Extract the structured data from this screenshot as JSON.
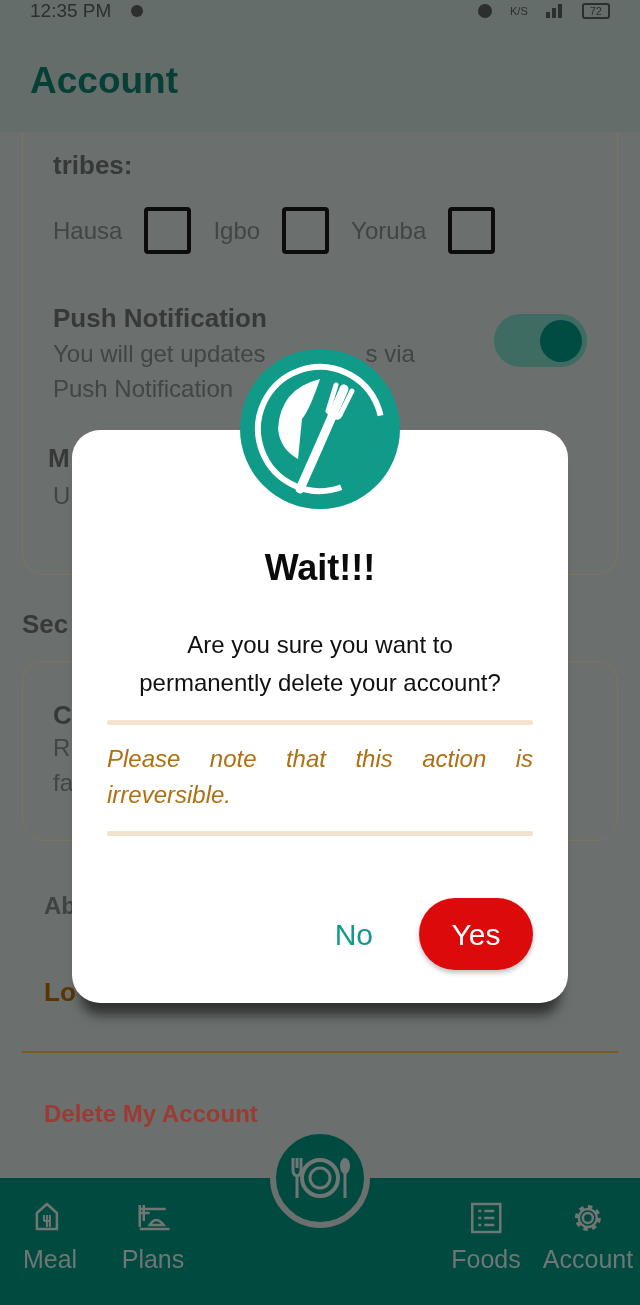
{
  "status_bar": {
    "time": "12:35 PM",
    "network_speed": "K/S",
    "battery": "72"
  },
  "app_bar": {
    "title": "Account"
  },
  "tribes": {
    "label": "tribes:",
    "options": [
      {
        "label": "Hausa",
        "checked": false
      },
      {
        "label": "Igbo",
        "checked": false
      },
      {
        "label": "Yoruba",
        "checked": false
      }
    ]
  },
  "push_notification": {
    "title": "Push Notification",
    "description_start": "You will get updates",
    "description_end": "s via",
    "description_line_2": "Push Notification",
    "on": true
  },
  "partial_card": {
    "title": "M",
    "subtitle": "U"
  },
  "section_title": "Sec",
  "card_2": {
    "title": "C",
    "lines": [
      "R",
      "fa"
    ]
  },
  "links": [
    {
      "label": "Ab",
      "kind": "plain"
    },
    {
      "label": "Lo",
      "kind": "accent"
    }
  ],
  "delete_account": "Delete My Account",
  "dialog": {
    "title": "Wait!!!",
    "message": "Are you sure you want to permanently delete your account?",
    "note": "Please note that this action is irreversible.",
    "buttons": [
      {
        "label": "No",
        "kind": "text"
      },
      {
        "label": "Yes",
        "kind": "danger"
      }
    ]
  },
  "bottom_nav": {
    "items": [
      {
        "label": "Meal"
      },
      {
        "label": "Plans"
      },
      {
        "label": "Foods"
      },
      {
        "label": "Account"
      }
    ]
  }
}
